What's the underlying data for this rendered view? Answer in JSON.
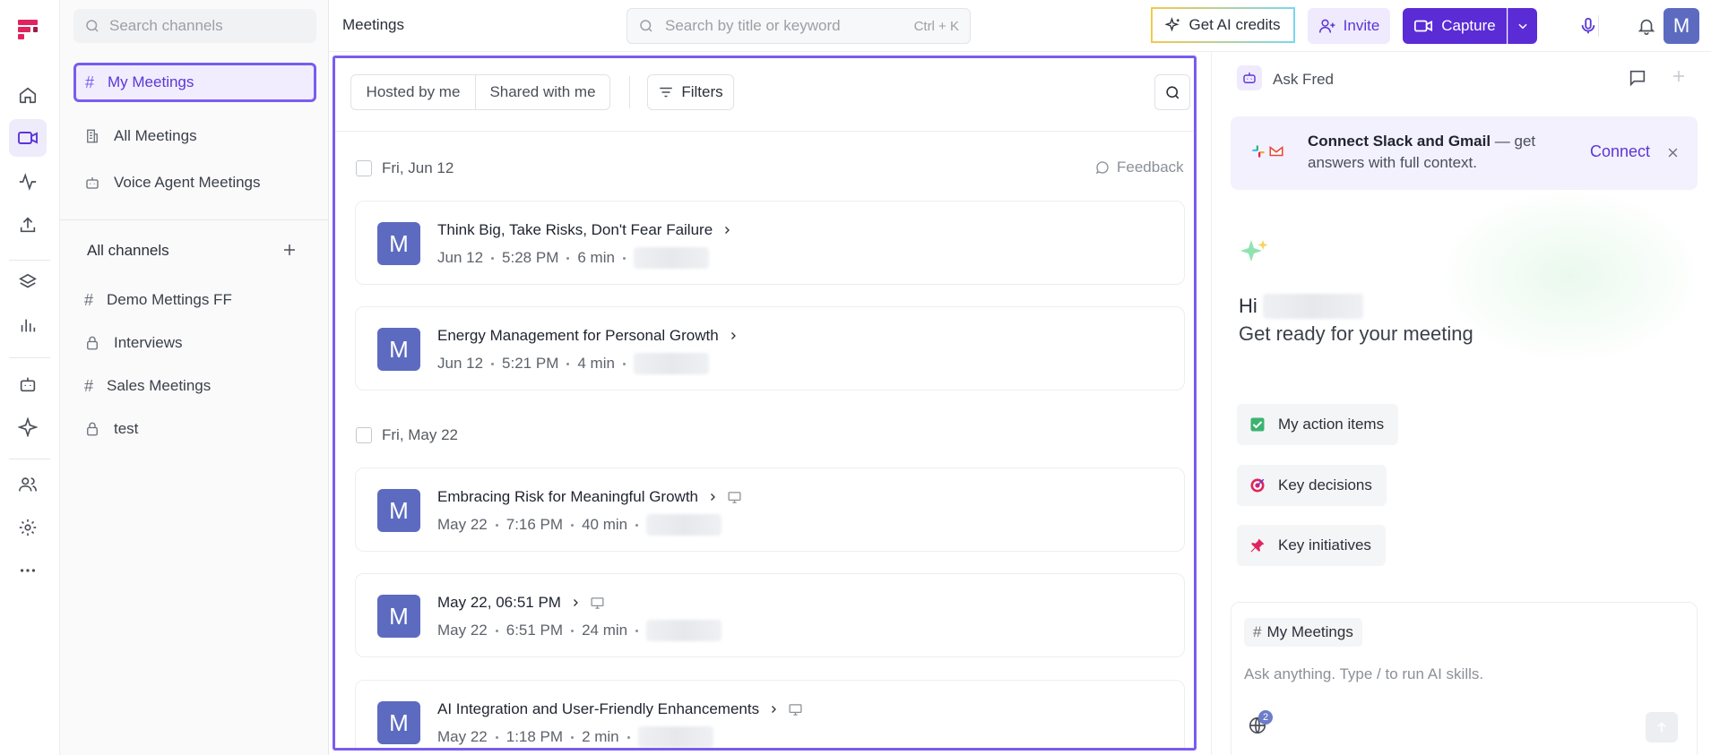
{
  "sidebar": {
    "search_placeholder": "Search channels",
    "top_items": [
      {
        "label": "My Meetings",
        "icon": "hash-icon",
        "selected": true
      },
      {
        "label": "All Meetings",
        "icon": "building-icon"
      },
      {
        "label": "Voice Agent Meetings",
        "icon": "bot-icon"
      }
    ],
    "channels_header": "All channels",
    "channels": [
      {
        "label": "Demo Mettings FF",
        "icon": "hash-icon"
      },
      {
        "label": "Interviews",
        "icon": "lock-icon"
      },
      {
        "label": "Sales Meetings",
        "icon": "hash-icon"
      },
      {
        "label": "test",
        "icon": "lock-icon"
      }
    ]
  },
  "topbar": {
    "page_title": "Meetings",
    "search_placeholder": "Search by title or keyword",
    "search_shortcut": "Ctrl + K",
    "ai_credits_label": "Get AI credits",
    "invite_label": "Invite",
    "capture_label": "Capture",
    "avatar_initial": "M"
  },
  "main": {
    "tabs": [
      "Hosted by me",
      "Shared with me"
    ],
    "filters_label": "Filters",
    "feedback_label": "Feedback",
    "groups": [
      {
        "date": "Fri, Jun 12",
        "meetings": [
          {
            "initial": "M",
            "title": "Think Big, Take Risks, Don't Fear Failure",
            "date": "Jun 12",
            "time": "5:28 PM",
            "duration": "6 min",
            "screen_icon": false
          },
          {
            "initial": "M",
            "title": "Energy Management for Personal Growth",
            "date": "Jun 12",
            "time": "5:21 PM",
            "duration": "4 min",
            "screen_icon": false
          }
        ]
      },
      {
        "date": "Fri, May 22",
        "meetings": [
          {
            "initial": "M",
            "title": "Embracing Risk for Meaningful Growth",
            "date": "May 22",
            "time": "7:16 PM",
            "duration": "40 min",
            "screen_icon": true
          },
          {
            "initial": "M",
            "title": "May 22, 06:51 PM",
            "date": "May 22",
            "time": "6:51 PM",
            "duration": "24 min",
            "screen_icon": true
          },
          {
            "initial": "M",
            "title": "AI Integration and User-Friendly Enhancements",
            "date": "May 22",
            "time": "1:18 PM",
            "duration": "2 min",
            "screen_icon": true
          }
        ]
      }
    ]
  },
  "right_panel": {
    "title": "Ask Fred",
    "connect_banner": {
      "bold": "Connect Slack and Gmail",
      "rest": " — get answers with full context.",
      "action": "Connect"
    },
    "greeting_hi": "Hi",
    "greeting_sub": "Get ready for your meeting",
    "suggestions": [
      {
        "label": "My action items",
        "icon": "checkbox-icon"
      },
      {
        "label": "Key decisions",
        "icon": "target-icon"
      },
      {
        "label": "Key initiatives",
        "icon": "pin-icon"
      }
    ],
    "composer_channel": "My Meetings",
    "composer_placeholder": "Ask anything. Type / to run AI skills.",
    "globe_badge": "2"
  },
  "colors": {
    "accent": "#7a5cf0",
    "capture": "#5b2bd6",
    "avatar": "#5c6bc0"
  }
}
